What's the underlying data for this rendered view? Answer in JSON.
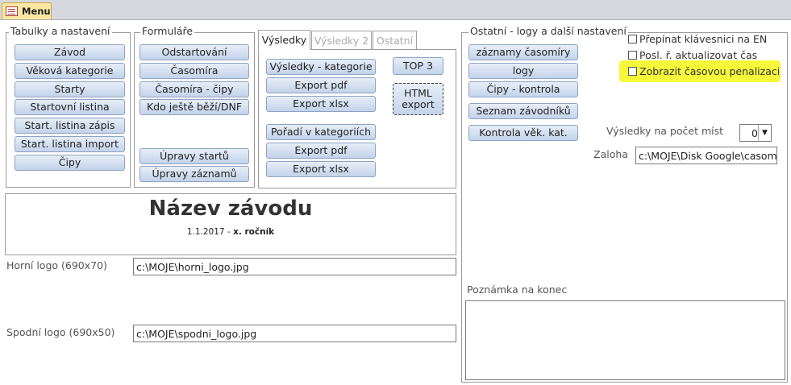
{
  "doc_tab": {
    "icon": "form-icon",
    "label": "Menu"
  },
  "tabulky": {
    "label": "Tabulky a nastavení",
    "buttons": [
      "Závod",
      "Věková kategorie",
      "Starty",
      "Startovní listina",
      "Start. listina zápis",
      "Start. listina import",
      "Čipy"
    ]
  },
  "formulare": {
    "label": "Formuláře",
    "buttons_top": [
      "Odstartování",
      "Časomíra",
      "Časomíra - čipy",
      "Kdo ještě běží/DNF"
    ],
    "buttons_bottom": [
      "Úpravy startů",
      "Úpravy záznamů"
    ]
  },
  "results_tabs": [
    "Výsledky",
    "Výsledky 2",
    "Ostatní"
  ],
  "vysledky": {
    "col1_top": [
      "Výsledky - kategorie",
      "Export pdf",
      "Export xlsx"
    ],
    "col1_bottom": [
      "Pořadí v kategoriích",
      "Export pdf",
      "Export xlsx"
    ],
    "top3": "TOP 3",
    "html_export_line1": "HTML",
    "html_export_line2": "export"
  },
  "race": {
    "title": "Název závodu",
    "date": "1.1.2017",
    "sep": " - ",
    "year": "x. ročník"
  },
  "logos": {
    "top_label": "Horní logo (690x70)",
    "top_value": "c:\\MOJE\\horni_logo.jpg",
    "bottom_label": "Spodní logo (690x50)",
    "bottom_value": "c:\\MOJE\\spodni_logo.jpg"
  },
  "ostatni": {
    "label": "Ostatní - logy a další nastavení",
    "buttons": [
      "záznamy časomíry",
      "logy",
      "Čipy - kontrola",
      "Seznam závodníků",
      "Kontrola věk. kat."
    ],
    "checkboxes": [
      "Přepínat klávesnici na EN",
      "Posl. ř. aktualizovat čas",
      "Zobrazit časovou penalizaci"
    ],
    "places_label": "Výsledky na počet míst",
    "places_value": "0",
    "backup_label": "Zaloha",
    "backup_value": "c:\\MOJE\\Disk Google\\casomira",
    "note_label": "Poznámka na konec",
    "note_value": ""
  },
  "colors": {
    "highlight": "#f6f83a",
    "button_border": "#8da3c2",
    "tab_accent": "#fbe7a1"
  }
}
